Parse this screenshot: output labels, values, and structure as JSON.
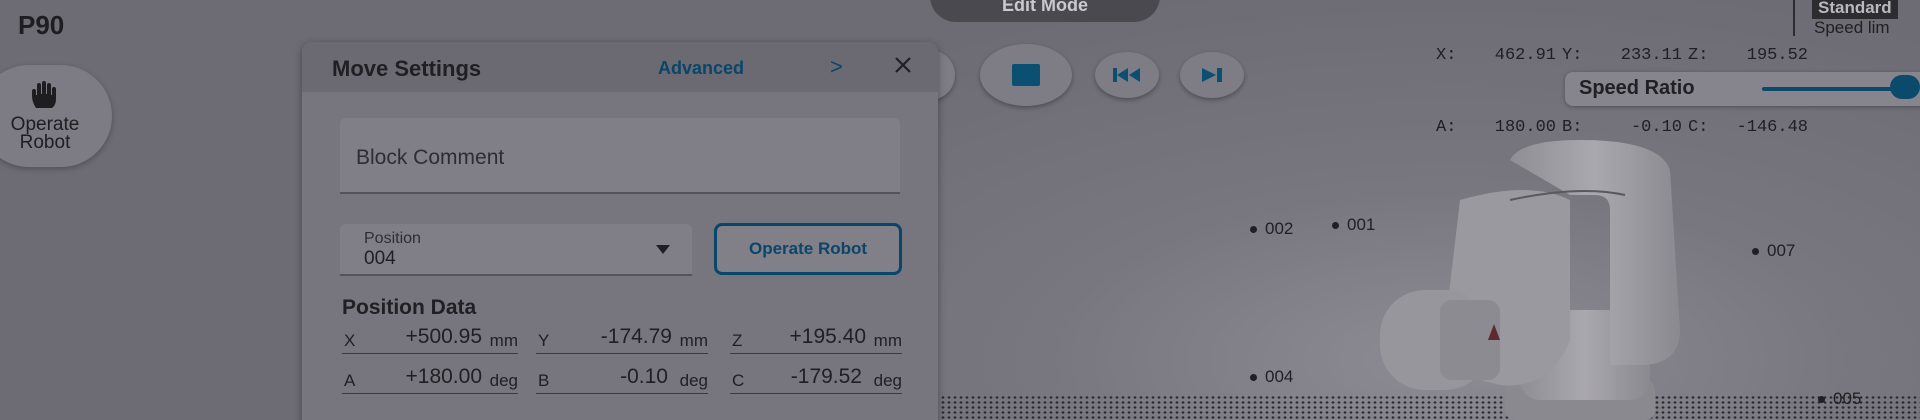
{
  "page": {
    "title": "P90"
  },
  "side": {
    "operate_robot_line1": "Operate",
    "operate_robot_line2": "Robot"
  },
  "header": {
    "mode": "Edit Mode"
  },
  "coords": {
    "row1": [
      [
        "X:",
        "462.91"
      ],
      [
        "Y:",
        "233.11"
      ],
      [
        "Z:",
        "195.52"
      ]
    ],
    "row2": [
      [
        "A:",
        "180.00"
      ],
      [
        "B:",
        "-0.10"
      ],
      [
        "C:",
        "-146.48"
      ]
    ],
    "badge": "Standard",
    "speed_limit": "Speed lim"
  },
  "speed_ratio": {
    "label": "Speed Ratio",
    "value": 1.0
  },
  "points": [
    "002",
    "001",
    "007",
    "004",
    "005"
  ],
  "panel": {
    "title": "Move Settings",
    "advanced": "Advanced",
    "chevron": ">",
    "comment_placeholder": "Block Comment",
    "position_label": "Position",
    "position_value": "004",
    "operate_button": "Operate Robot",
    "position_data_title": "Position Data",
    "fields": [
      {
        "axis": "X",
        "value": "+500.95",
        "unit": "mm"
      },
      {
        "axis": "Y",
        "value": "-174.79",
        "unit": "mm"
      },
      {
        "axis": "Z",
        "value": "+195.40",
        "unit": "mm"
      },
      {
        "axis": "A",
        "value": "+180.00",
        "unit": "deg"
      },
      {
        "axis": "B",
        "value": "-0.10",
        "unit": "deg"
      },
      {
        "axis": "C",
        "value": "-179.52",
        "unit": "deg"
      }
    ]
  },
  "colors": {
    "accent": "#0a466a",
    "overlay": "#6f6d75"
  },
  "icons": [
    "hand-icon",
    "stop-icon",
    "skip-back-icon",
    "skip-forward-icon",
    "close-icon",
    "chevron-right-icon",
    "dropdown-caret-icon"
  ]
}
